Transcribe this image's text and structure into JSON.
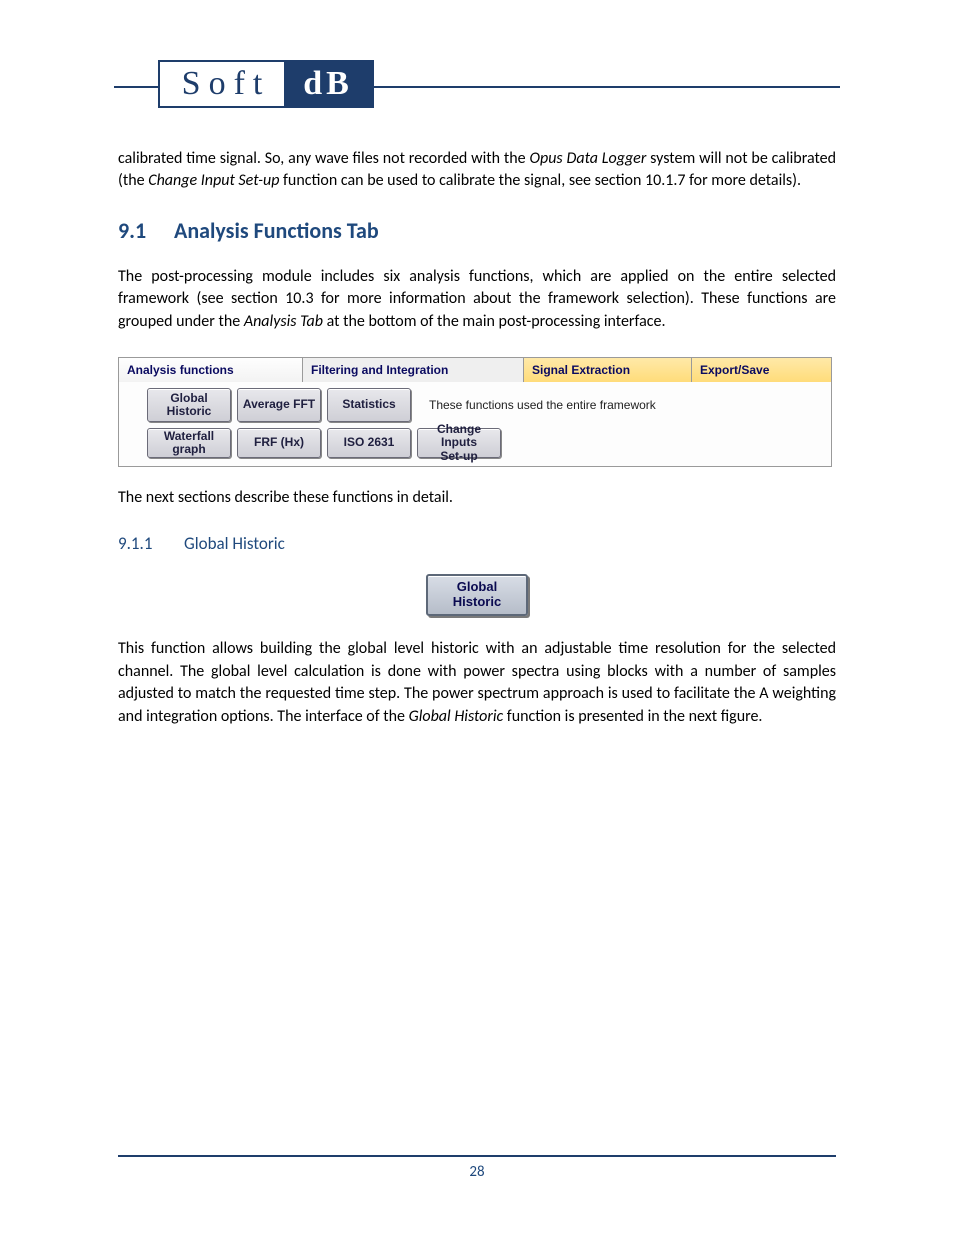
{
  "logo": {
    "left": "Soft",
    "right": "dB"
  },
  "intro": {
    "pre": "calibrated time signal. So, any wave files not recorded with the ",
    "em1": "Opus Data Logger",
    "mid1": " system will not be calibrated (the ",
    "em2": "Change Input Set-up",
    "post": " function can be used to calibrate the signal, see section 10.1.7 for more details)."
  },
  "h2": {
    "num": "9.1",
    "title": "Analysis Functions Tab"
  },
  "para2": {
    "pre": "The post-processing module includes six analysis functions, which are applied on the entire selected framework (see section 10.3 for more information about the framework selection). These functions are grouped under the ",
    "em": "Analysis Tab",
    "post": " at the bottom of the main post-processing interface."
  },
  "tabs": {
    "t1": "Analysis functions",
    "t2": "Filtering and Integration",
    "t3": "Signal Extraction",
    "t4": "Export/Save"
  },
  "buttons": {
    "r1c1": "Global\nHistoric",
    "r1c2": "Average FFT",
    "r1c3": "Statistics",
    "note": "These functions used the entire framework",
    "r2c1": "Waterfall\ngraph",
    "r2c2": "FRF (Hx)",
    "r2c3": "ISO 2631",
    "r2c4": "Change Inputs\nSet-up"
  },
  "para3": "The next sections describe these functions in detail.",
  "h3": {
    "num": "9.1.1",
    "title": "Global Historic"
  },
  "solo_button": "Global\nHistoric",
  "para4": {
    "pre": "This function allows building the global level historic with an adjustable time resolution for the selected channel. The global level calculation is done with power spectra using blocks with a number of samples adjusted to match the requested time step. The power spectrum approach is used to facilitate the A weighting and integration options. The interface of the ",
    "em": "Global Historic",
    "post": " function is presented in the next figure."
  },
  "page_number": "28"
}
